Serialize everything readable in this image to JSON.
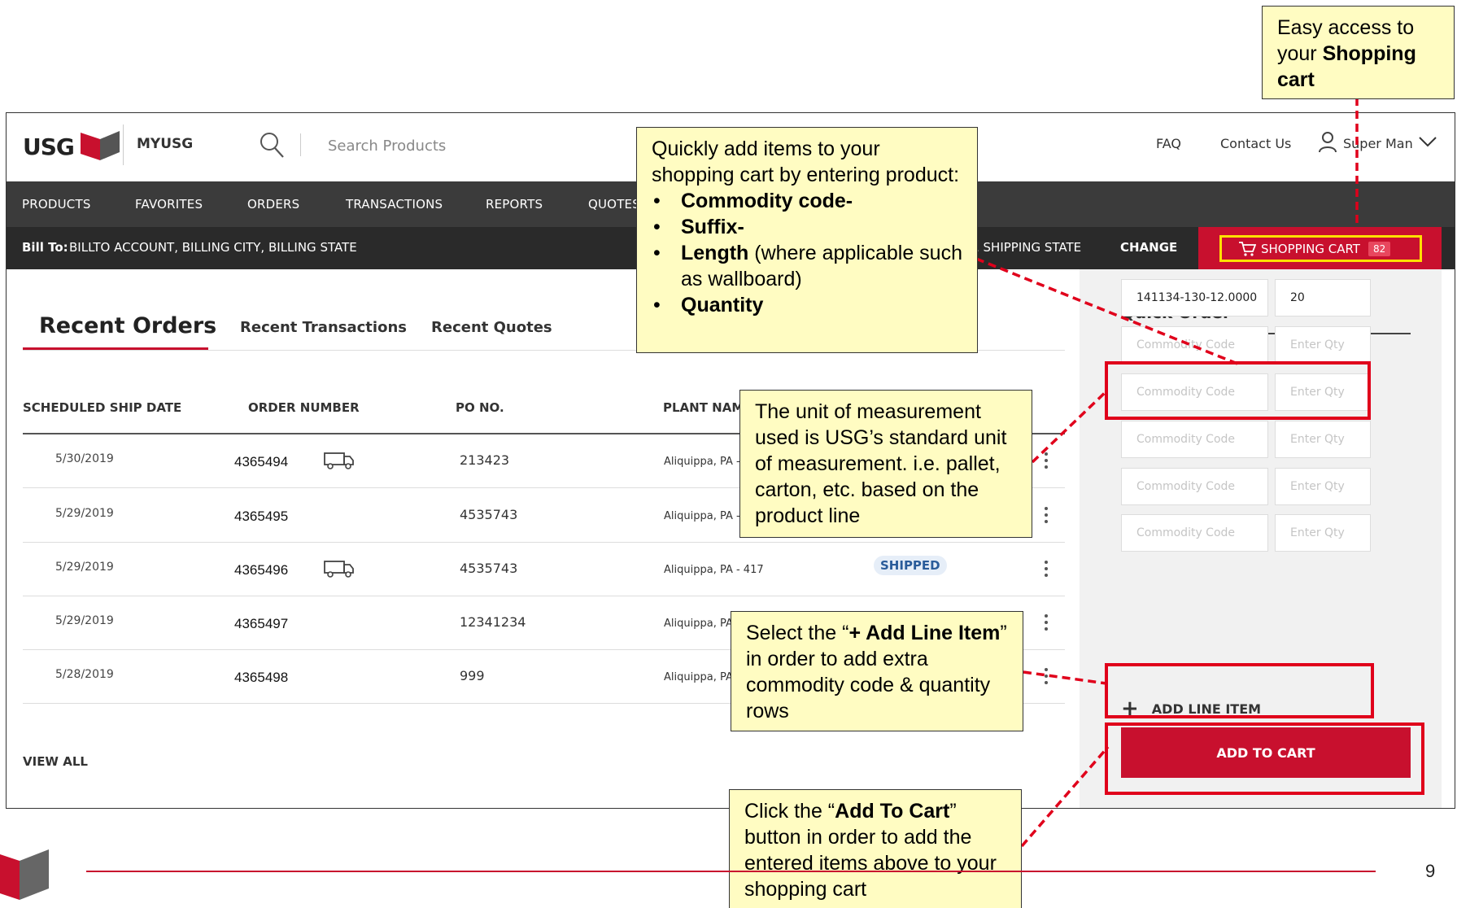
{
  "header": {
    "logo_text": "USG",
    "app_name": "MYUSG",
    "search_placeholder": "Search Products",
    "faq": "FAQ",
    "contact": "Contact Us",
    "user_name": "Super Man"
  },
  "nav": [
    "PRODUCTS",
    "FAVORITES",
    "ORDERS",
    "TRANSACTIONS",
    "REPORTS",
    "QUOTES"
  ],
  "bill_bar": {
    "label": "Bill To:",
    "address": "BILLTO ACCOUNT, BILLING CITY, BILLING STATE",
    "ship_to_tail": ", SHIPPING STATE",
    "change": "CHANGE",
    "cart_label": "SHOPPING CART",
    "cart_count": "82"
  },
  "tabs": [
    "Recent Orders",
    "Recent Transactions",
    "Recent Quotes"
  ],
  "table": {
    "headers": [
      "SCHEDULED SHIP DATE",
      "ORDER NUMBER",
      "PO NO.",
      "PLANT NAM"
    ],
    "rows": [
      {
        "date": "5/30/2019",
        "order": "4365494",
        "po": "213423",
        "plant": "Aliquippa, PA -",
        "truck": true,
        "status": "",
        "menu": "more-vertical-icon"
      },
      {
        "date": "5/29/2019",
        "order": "4365495",
        "po": "4535743",
        "plant": "Aliquippa, PA -",
        "truck": false,
        "status": "",
        "menu": "more-vertical-icon"
      },
      {
        "date": "5/29/2019",
        "order": "4365496",
        "po": "4535743",
        "plant": "Aliquippa, PA - 417",
        "truck": true,
        "status": "SHIPPED",
        "menu": "more-vertical-icon"
      },
      {
        "date": "5/29/2019",
        "order": "4365497",
        "po": "12341234",
        "plant": "Aliquippa, PA",
        "truck": false,
        "status": "",
        "menu": "more-vertical-icon"
      },
      {
        "date": "5/28/2019",
        "order": "4365498",
        "po": "999",
        "plant": "Aliquippa, PA",
        "truck": false,
        "status": "",
        "menu": "more-vertical-icon"
      }
    ],
    "view_all": "VIEW ALL"
  },
  "quick_order": {
    "title": "Quick Order",
    "rows": [
      {
        "code": "141134-130-12.0000",
        "qty": "20"
      },
      {
        "code": "",
        "qty": ""
      },
      {
        "code": "",
        "qty": ""
      },
      {
        "code": "",
        "qty": ""
      },
      {
        "code": "",
        "qty": ""
      },
      {
        "code": "",
        "qty": ""
      }
    ],
    "code_placeholder": "Commodity Code",
    "qty_placeholder": "Enter Qty",
    "add_line": "ADD LINE ITEM",
    "add_to_cart": "ADD TO CART"
  },
  "callouts": {
    "cart": {
      "pre": "Easy access to your ",
      "bold": "Shopping cart"
    },
    "quick": {
      "intro": "Quickly add items to your shopping cart by entering product:",
      "items": [
        {
          "bold": "Commodity code-",
          "rest": ""
        },
        {
          "bold": "Suffix-",
          "rest": ""
        },
        {
          "bold": "Length",
          "rest": " (where applicable such as wallboard)"
        },
        {
          "bold": "Quantity",
          "rest": ""
        }
      ]
    },
    "uom": "The unit of measurement used is USG’s standard unit of measurement. i.e. pallet, carton, etc. based on the product line",
    "addline": {
      "pre": "Select the “",
      "bold": "+ Add Line Item",
      "post": "” in order to add extra commodity code & quantity rows"
    },
    "addcart": {
      "pre": "Click the “",
      "bold": "Add To Cart",
      "post": "” button in order to add the entered items above to your shopping cart"
    }
  },
  "page_number": "9",
  "colors": {
    "brand_red": "#c8102e",
    "nav_dark": "#3b3b3b",
    "callout_bg": "#fffcc2",
    "highlight_yellow": "#ffe100",
    "status_blue": "#2a5c9a"
  }
}
